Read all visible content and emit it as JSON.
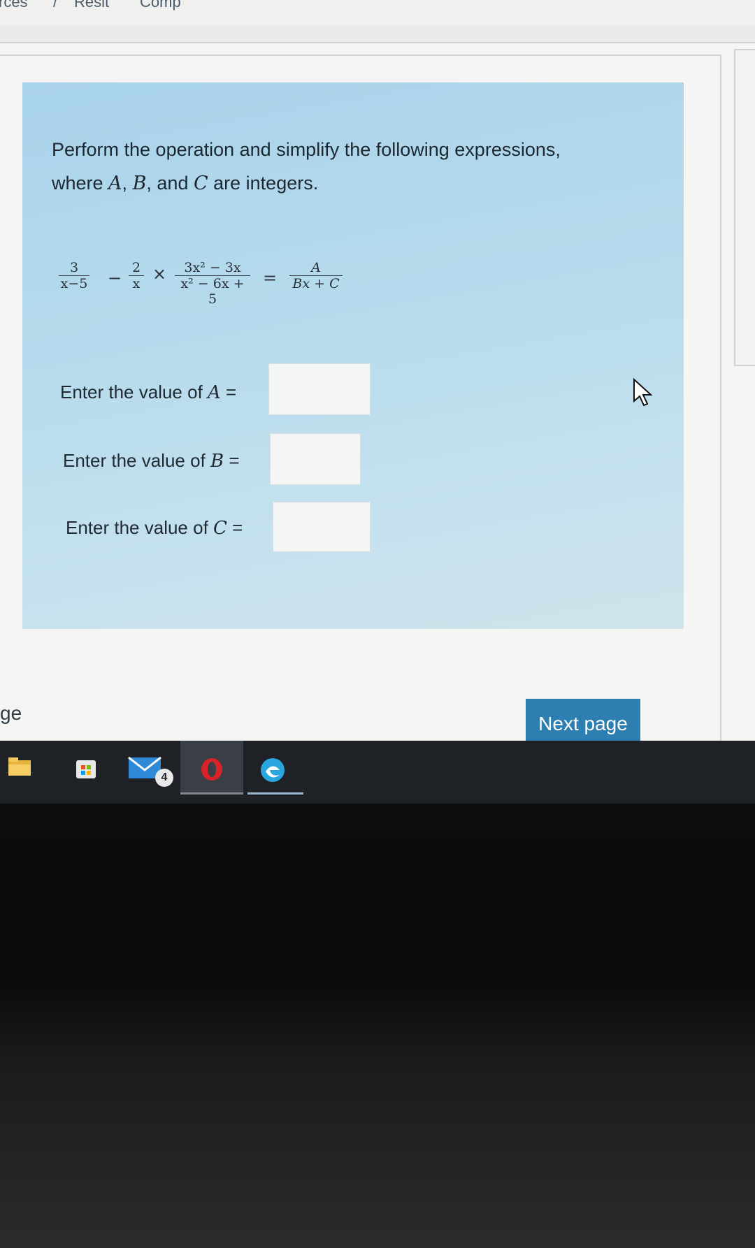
{
  "breadcrumb": {
    "left": "rces",
    "separator": "/",
    "middle": "Resit",
    "right": "Comp"
  },
  "question": {
    "prompt_line1": "Perform the operation and simplify the following expressions,",
    "prompt_line2_pre": "where ",
    "var_a": "A",
    "comma1": ", ",
    "var_b": "B",
    "comma2": ", and ",
    "var_c": "C",
    "prompt_line2_post": " are integers.",
    "equation": {
      "frac1_num": "3",
      "frac1_den": "x−5",
      "minus": "−",
      "frac2_num": "2",
      "frac2_den": "x",
      "times": "×",
      "frac3_num": "3x² − 3x",
      "frac3_den": "x² − 6x + 5",
      "equals": "=",
      "frac4_num": "A",
      "frac4_den": "Bx + C"
    }
  },
  "fields": [
    {
      "label": "Enter the value of ",
      "var": "A",
      "suffix": " =",
      "value": ""
    },
    {
      "label": "Enter the value of ",
      "var": "B",
      "suffix": " =",
      "value": ""
    },
    {
      "label": "Enter the value of ",
      "var": "C",
      "suffix": " =",
      "value": ""
    }
  ],
  "page_edge_text": "ge",
  "next_button_label": "Next page",
  "taskbar": {
    "mail_badge": "4",
    "icons": [
      "file-explorer-icon",
      "store-icon",
      "mail-icon",
      "opera-icon",
      "edge-icon"
    ]
  },
  "colors": {
    "card_blue": "#b5daec",
    "button_blue": "#2c7fb0",
    "taskbar": "#1e2126"
  }
}
